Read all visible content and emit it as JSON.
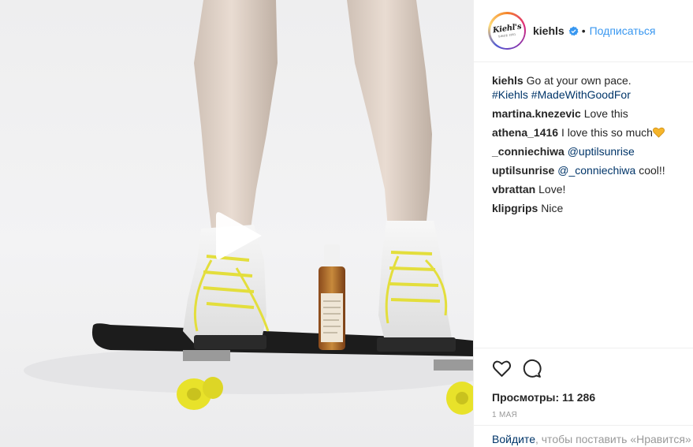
{
  "post": {
    "username": "kiehls",
    "follow_label": "Подписаться",
    "separator": "•",
    "avatar": {
      "logo_text": "Kiehl's",
      "logo_sub": "SINCE 1851"
    }
  },
  "caption": {
    "username": "kiehls",
    "text": "Go at your own pace.",
    "hashtags": "#Kiehls #MadeWithGoodFor"
  },
  "comments": [
    {
      "user": "martina.knezevic",
      "text": "Love this"
    },
    {
      "user": "athena_1416",
      "text": "I love this so much",
      "emoji": "yellow-heart"
    },
    {
      "user": "_conniechiwa",
      "mention": "@uptilsunrise",
      "text": ""
    },
    {
      "user": "uptilsunrise",
      "mention": "@_conniechiwa",
      "text": "cool!!"
    },
    {
      "user": "vbrattan",
      "text": "Love!"
    },
    {
      "user": "klipgrips",
      "text": "Nice"
    }
  ],
  "stats": {
    "views_label": "Просмотры: 11 286",
    "date": "1 мая"
  },
  "login_prompt": {
    "link": "Войдите",
    "rest": ", чтобы поставить «Нравится»"
  },
  "icons": [
    "heart-icon",
    "comment-icon",
    "play-icon",
    "verified-badge-icon"
  ],
  "colors": {
    "link": "#003569",
    "follow": "#3897f0",
    "muted": "#999999",
    "verified": "#3897f0"
  }
}
